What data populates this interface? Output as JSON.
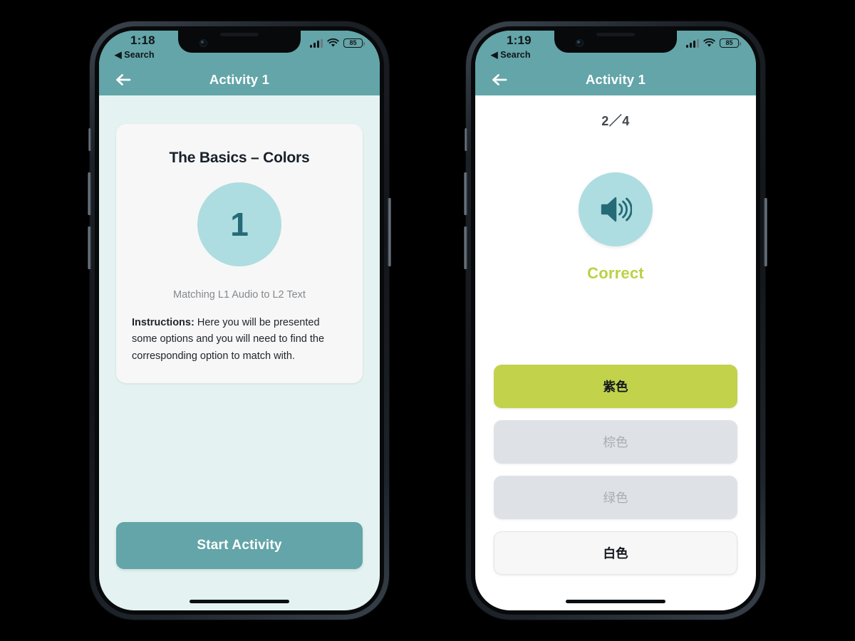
{
  "theme": {
    "header_teal": "#63A5A8",
    "page_mint": "#E4F3F1",
    "circle_cyan": "#ADDDE0",
    "circle_number_color": "#256B77",
    "correct_green": "#BCD143",
    "option_green": "#C2D24B",
    "option_gray": "#DEE2E6"
  },
  "phones": [
    {
      "id": "intro-screen",
      "status_bar": {
        "time": "1:18",
        "back_label": "◀ Search",
        "battery": "85",
        "signal_icon": "cellular-bars-icon",
        "wifi_icon": "wifi-icon",
        "battery_icon": "battery-icon"
      },
      "navbar": {
        "back_icon": "back-arrow-icon",
        "title": "Activity 1"
      },
      "card": {
        "title": "The Basics – Colors",
        "number": "1",
        "subtitle": "Matching L1 Audio to L2 Text",
        "instructions_label": "Instructions:",
        "instructions_text": " Here you will be presented some options and you will need to find the corresponding option to match with."
      },
      "start_button": "Start Activity"
    },
    {
      "id": "quiz-screen",
      "status_bar": {
        "time": "1:19",
        "back_label": "◀ Search",
        "battery": "85",
        "signal_icon": "cellular-bars-icon",
        "wifi_icon": "wifi-icon",
        "battery_icon": "battery-icon"
      },
      "navbar": {
        "back_icon": "back-arrow-icon",
        "title": "Activity 1"
      },
      "quiz": {
        "counter": "2／4",
        "audio_icon": "speaker-volume-icon",
        "feedback": "Correct",
        "options": [
          {
            "label": "紫色",
            "state": "correct"
          },
          {
            "label": "棕色",
            "state": "disabled"
          },
          {
            "label": "绿色",
            "state": "disabled"
          },
          {
            "label": "白色",
            "state": "neutral"
          }
        ]
      }
    }
  ]
}
